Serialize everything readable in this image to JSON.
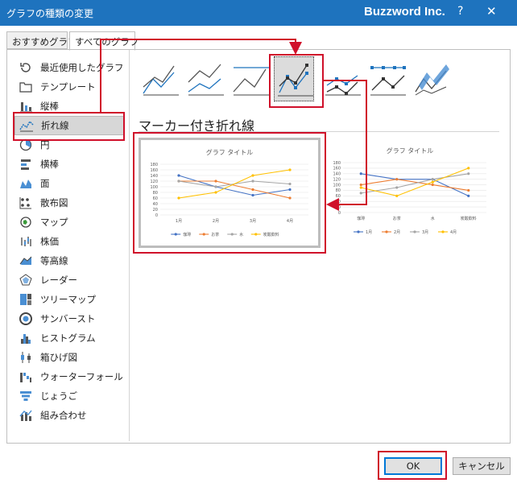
{
  "window": {
    "title": "グラフの種類の変更",
    "brand": "Buzzword Inc.",
    "help": "?",
    "close": "✕"
  },
  "tabs": [
    {
      "label": "おすすめグラフ"
    },
    {
      "label": "すべてのグラフ"
    }
  ],
  "sidebar": {
    "items": [
      {
        "label": "最近使用したグラフ",
        "icon": "recent-icon"
      },
      {
        "label": "テンプレート",
        "icon": "folder-icon"
      },
      {
        "label": "縦棒",
        "icon": "column-chart-icon"
      },
      {
        "label": "折れ線",
        "icon": "line-chart-icon",
        "selected": true
      },
      {
        "label": "円",
        "icon": "pie-chart-icon"
      },
      {
        "label": "横棒",
        "icon": "bar-chart-icon"
      },
      {
        "label": "面",
        "icon": "area-chart-icon"
      },
      {
        "label": "散布図",
        "icon": "scatter-chart-icon"
      },
      {
        "label": "マップ",
        "icon": "map-icon"
      },
      {
        "label": "株価",
        "icon": "stock-chart-icon"
      },
      {
        "label": "等高線",
        "icon": "surface-chart-icon"
      },
      {
        "label": "レーダー",
        "icon": "radar-chart-icon"
      },
      {
        "label": "ツリーマップ",
        "icon": "treemap-icon"
      },
      {
        "label": "サンバースト",
        "icon": "sunburst-icon"
      },
      {
        "label": "ヒストグラム",
        "icon": "histogram-icon"
      },
      {
        "label": "箱ひげ図",
        "icon": "boxplot-icon"
      },
      {
        "label": "ウォーターフォール",
        "icon": "waterfall-icon"
      },
      {
        "label": "じょうご",
        "icon": "funnel-icon"
      },
      {
        "label": "組み合わせ",
        "icon": "combo-chart-icon"
      }
    ]
  },
  "subtypes": {
    "selected_title": "マーカー付き折れ線",
    "items": [
      "line",
      "stacked-line",
      "stacked-line-100",
      "line-markers",
      "stacked-line-markers",
      "stacked-line-100-markers",
      "3d-line"
    ]
  },
  "colors": {
    "accent": "#1e73be",
    "highlight": "#d0102a",
    "series1": "#4472c4",
    "series2": "#ed7d31",
    "series3": "#a5a5a5",
    "series4": "#ffc000"
  },
  "buttons": {
    "ok": "OK",
    "cancel": "キャンセル"
  },
  "chart_data": [
    {
      "type": "line",
      "title": "グラフ タイトル",
      "categories": [
        "1月",
        "2月",
        "3月",
        "4月"
      ],
      "series": [
        {
          "name": "珈琲",
          "values": [
            140,
            100,
            70,
            90
          ]
        },
        {
          "name": "お茶",
          "values": [
            120,
            120,
            90,
            60
          ]
        },
        {
          "name": "水",
          "values": [
            120,
            100,
            120,
            110
          ]
        },
        {
          "name": "炭酸飲料",
          "values": [
            60,
            80,
            140,
            160
          ]
        }
      ],
      "yticks": [
        "180",
        "160",
        "140",
        "120",
        "100",
        "80",
        "60",
        "40",
        "20",
        "0"
      ],
      "ylim": [
        0,
        180
      ],
      "legend": "bottom"
    },
    {
      "type": "line",
      "title": "グラフ タイトル",
      "categories": [
        "珈琲",
        "お茶",
        "水",
        "炭酸飲料"
      ],
      "series": [
        {
          "name": "1月",
          "values": [
            140,
            120,
            120,
            60
          ]
        },
        {
          "name": "2月",
          "values": [
            100,
            120,
            100,
            80
          ]
        },
        {
          "name": "3月",
          "values": [
            70,
            90,
            120,
            140
          ]
        },
        {
          "name": "4月",
          "values": [
            90,
            60,
            110,
            160
          ]
        }
      ],
      "yticks": [
        "180",
        "160",
        "140",
        "120",
        "100",
        "80",
        "60",
        "40",
        "20",
        "0"
      ],
      "ylim": [
        0,
        180
      ],
      "legend": "bottom"
    }
  ]
}
